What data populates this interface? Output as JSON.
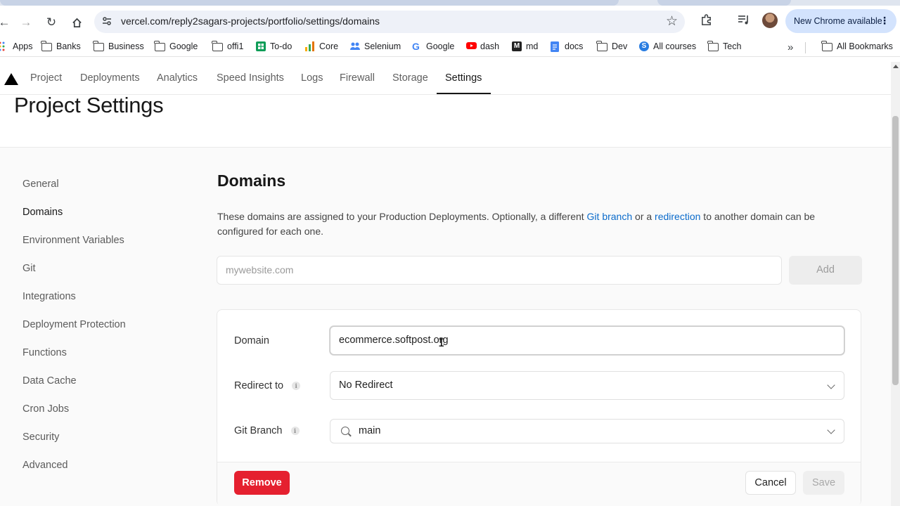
{
  "browser": {
    "url": "vercel.com/reply2sagars-projects/portfolio/settings/domains",
    "new_chrome_label": "New Chrome available",
    "bookmarks": [
      {
        "label": "Apps",
        "icon": "apps-grid-icon"
      },
      {
        "label": "Banks",
        "icon": "folder-icon"
      },
      {
        "label": "Business",
        "icon": "folder-icon"
      },
      {
        "label": "Google",
        "icon": "folder-icon"
      },
      {
        "label": "offi1",
        "icon": "folder-icon"
      },
      {
        "label": "To-do",
        "icon": "sheets-icon"
      },
      {
        "label": "Core",
        "icon": "bar-chart-icon"
      },
      {
        "label": "Selenium",
        "icon": "people-icon"
      },
      {
        "label": "Google",
        "icon": "google-g-icon"
      },
      {
        "label": "dash",
        "icon": "youtube-icon"
      },
      {
        "label": "md",
        "icon": "m-icon"
      },
      {
        "label": "docs",
        "icon": "docs-icon"
      },
      {
        "label": "Dev",
        "icon": "folder-icon"
      },
      {
        "label": "All courses",
        "icon": "s-icon"
      },
      {
        "label": "Tech",
        "icon": "folder-icon"
      }
    ],
    "all_bookmarks_label": "All Bookmarks"
  },
  "nav": {
    "tabs": [
      "Project",
      "Deployments",
      "Analytics",
      "Speed Insights",
      "Logs",
      "Firewall",
      "Storage",
      "Settings"
    ],
    "active_tab": "Settings"
  },
  "page": {
    "title": "Project Settings"
  },
  "sidebar": {
    "items": [
      "General",
      "Domains",
      "Environment Variables",
      "Git",
      "Integrations",
      "Deployment Protection",
      "Functions",
      "Data Cache",
      "Cron Jobs",
      "Security",
      "Advanced"
    ],
    "active": "Domains"
  },
  "domains": {
    "title": "Domains",
    "description_part1": "These domains are assigned to your Production Deployments. Optionally, a different ",
    "link_git_branch": "Git branch",
    "description_part2": " or a ",
    "link_redirection": "redirection",
    "description_part3": " to another domain can be configured for each one.",
    "add_placeholder": "mywebsite.com",
    "add_button": "Add",
    "card": {
      "domain_label": "Domain",
      "domain_value": "ecommerce.softpost.org",
      "redirect_label": "Redirect to",
      "redirect_value": "No Redirect",
      "branch_label": "Git Branch",
      "branch_value": "main",
      "remove_button": "Remove",
      "cancel_button": "Cancel",
      "save_button": "Save"
    }
  }
}
